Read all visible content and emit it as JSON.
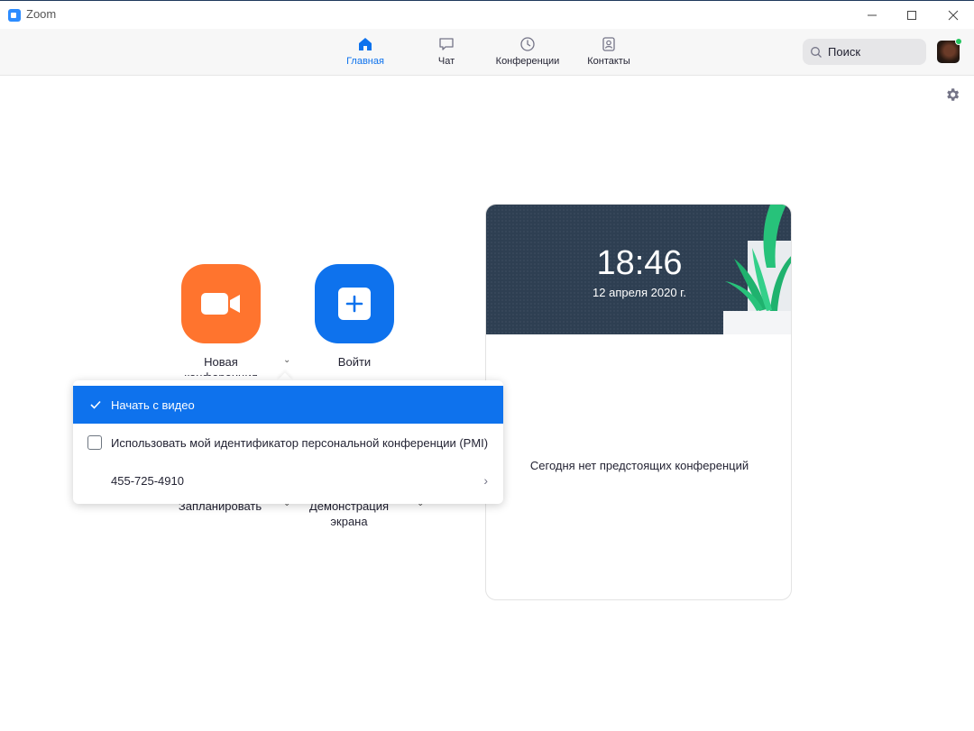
{
  "window": {
    "title": "Zoom",
    "accent": "#0e72ed"
  },
  "nav": {
    "tabs": [
      {
        "label": "Главная",
        "icon": "home-icon",
        "active": true
      },
      {
        "label": "Чат",
        "icon": "chat-icon",
        "active": false
      },
      {
        "label": "Конференции",
        "icon": "clock-icon",
        "active": false
      },
      {
        "label": "Контакты",
        "icon": "contacts-icon",
        "active": false
      }
    ],
    "search_placeholder": "Поиск"
  },
  "actions": {
    "new_meeting": "Новая конференция",
    "join": "Войти",
    "schedule": "Запланировать",
    "share_screen": "Демонстрация экрана"
  },
  "menu": {
    "items": [
      {
        "label": "Начать с видео",
        "selected": true
      },
      {
        "label": "Использовать мой идентификатор персональной конференции (PMI)",
        "checked": false
      },
      {
        "label": "455-725-4910"
      }
    ]
  },
  "calendar": {
    "time": "18:46",
    "date": "12 апреля 2020 г.",
    "empty_text": "Сегодня нет предстоящих конференций"
  },
  "colors": {
    "orange": "#ff742e",
    "blue": "#0e72ed",
    "online": "#24c55f"
  }
}
